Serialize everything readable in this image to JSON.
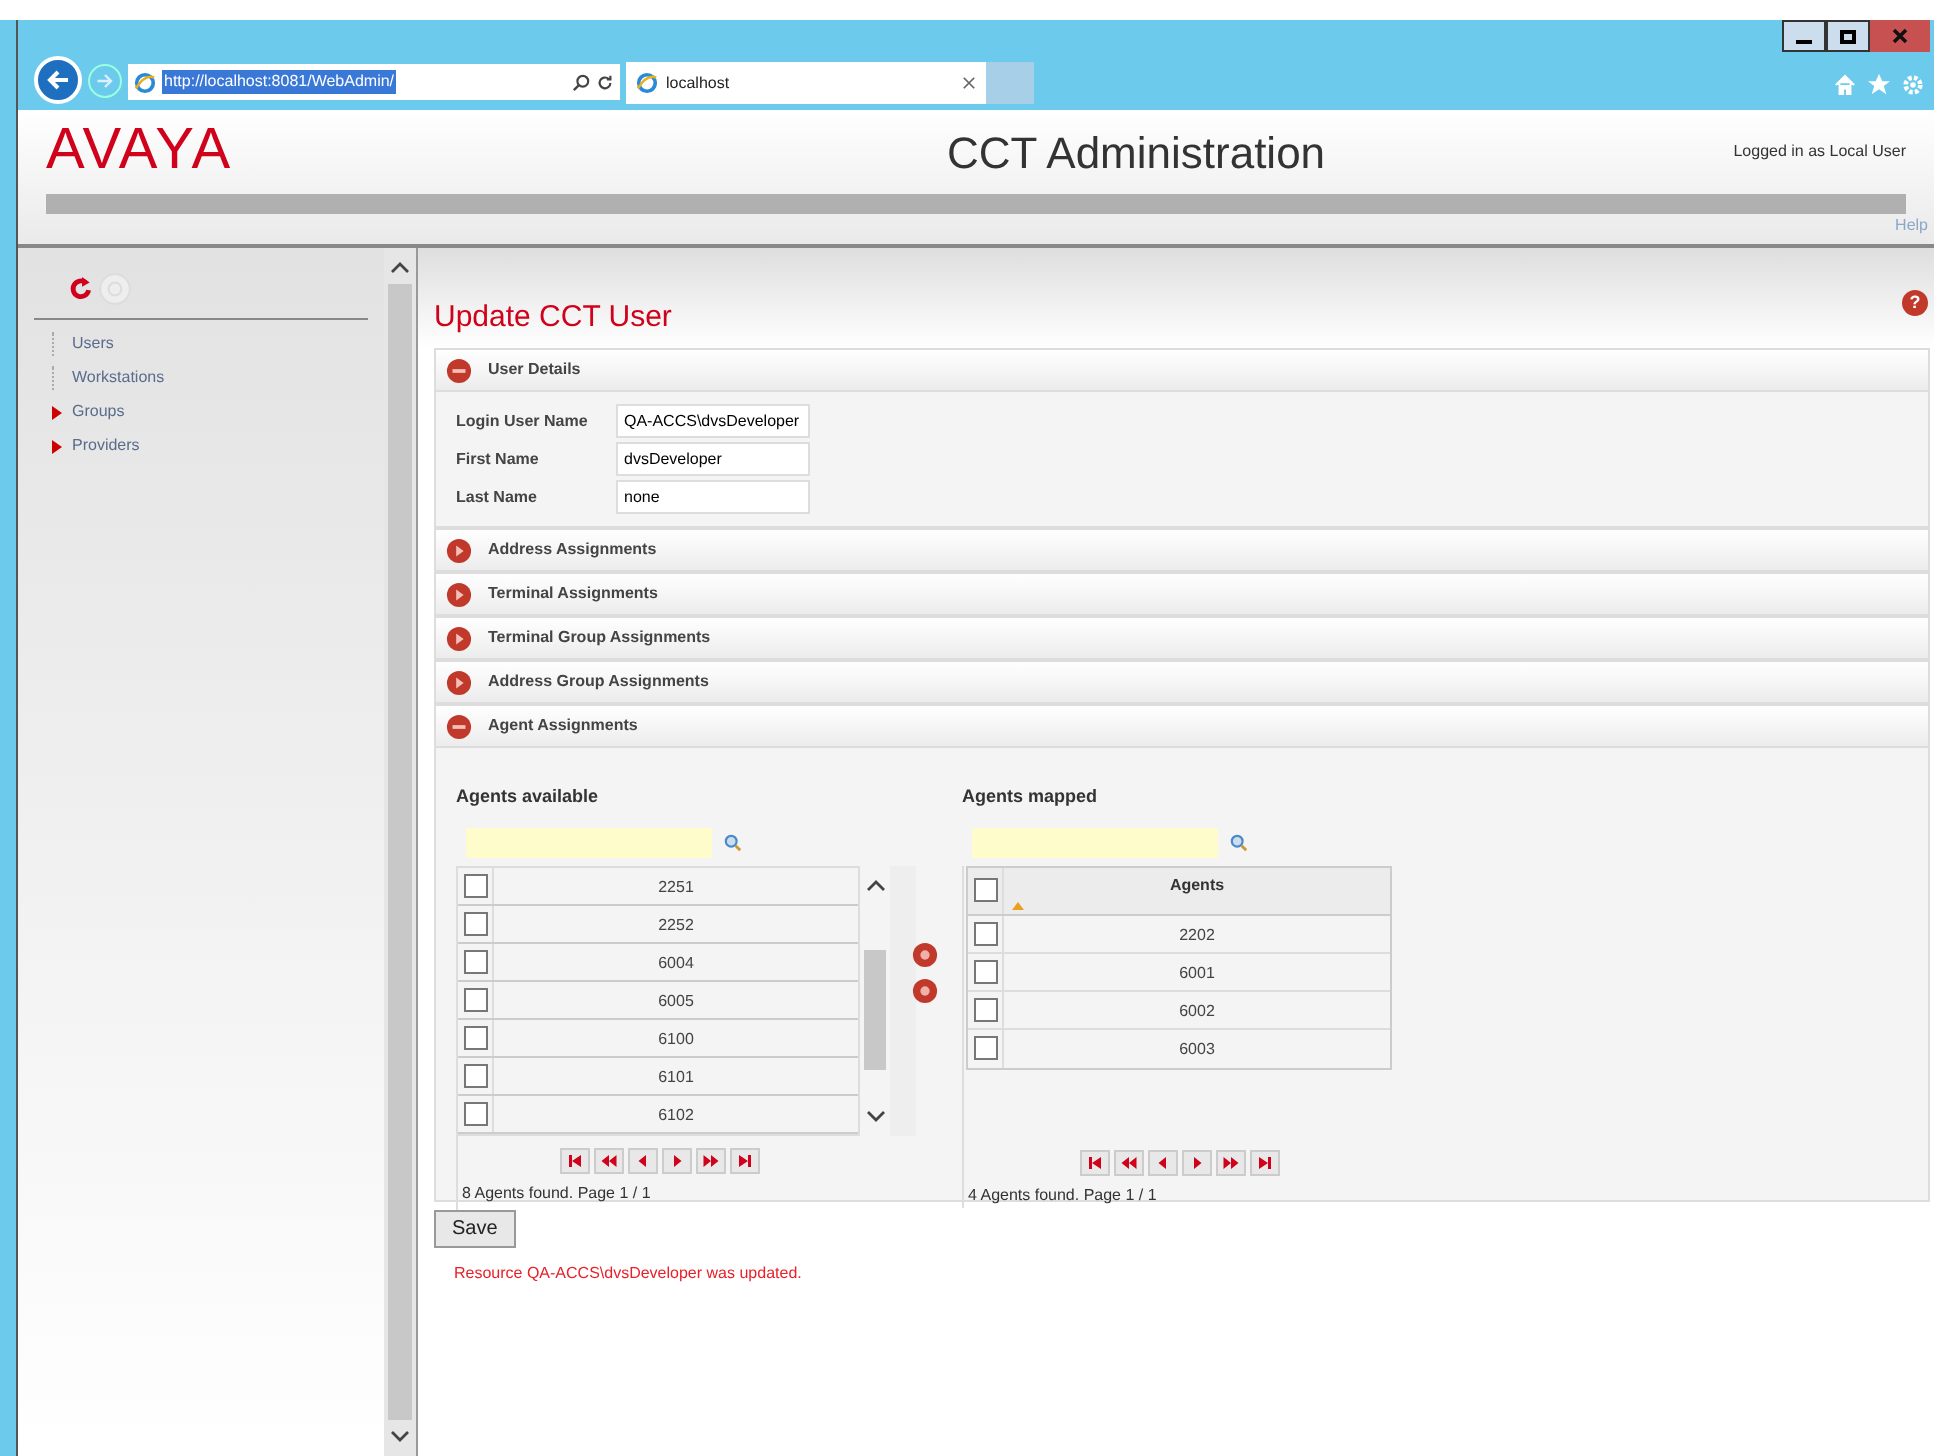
{
  "browser": {
    "url": "http://localhost:8081/WebAdmin/",
    "tab_title": "localhost"
  },
  "header": {
    "logo": "AVAYA",
    "title": "CCT Administration",
    "login_text": "Logged in as Local User",
    "help": "Help"
  },
  "sidebar": {
    "items": [
      {
        "label": "Users",
        "kind": "leaf"
      },
      {
        "label": "Workstations",
        "kind": "leaf"
      },
      {
        "label": "Groups",
        "kind": "group"
      },
      {
        "label": "Providers",
        "kind": "group"
      }
    ]
  },
  "page_title": "Update CCT User",
  "help_icon_text": "?",
  "sections": [
    {
      "title": "User Details",
      "expanded": true,
      "kind": "details"
    },
    {
      "title": "Address Assignments",
      "expanded": false
    },
    {
      "title": "Terminal Assignments",
      "expanded": false
    },
    {
      "title": "Terminal Group Assignments",
      "expanded": false
    },
    {
      "title": "Address Group Assignments",
      "expanded": false
    },
    {
      "title": "Agent Assignments",
      "expanded": true,
      "kind": "agents"
    }
  ],
  "user_fields": [
    {
      "label": "Login User Name",
      "value": "QA-ACCS\\dvsDeveloper"
    },
    {
      "label": "First Name",
      "value": "dvsDeveloper"
    },
    {
      "label": "Last Name",
      "value": "none"
    }
  ],
  "agents_available": {
    "title": "Agents available",
    "rows": [
      {
        "value": "2251",
        "checked": false
      },
      {
        "value": "2252",
        "checked": false
      },
      {
        "value": "6004",
        "checked": false
      },
      {
        "value": "6005",
        "checked": false
      },
      {
        "value": "6100",
        "checked": false
      },
      {
        "value": "6101",
        "checked": false
      },
      {
        "value": "6102",
        "checked": false
      }
    ],
    "footer": "8 Agents found. Page 1 / 1"
  },
  "agents_mapped": {
    "title": "Agents mapped",
    "column": "Agents",
    "header_checked": false,
    "rows": [
      {
        "value": "2202",
        "checked": false
      },
      {
        "value": "6001",
        "checked": false
      },
      {
        "value": "6002",
        "checked": false
      },
      {
        "value": "6003",
        "checked": false
      }
    ],
    "footer": "4 Agents found. Page 1 / 1"
  },
  "save_button": "Save",
  "message": "Resource QA-ACCS\\dvsDeveloper was updated."
}
